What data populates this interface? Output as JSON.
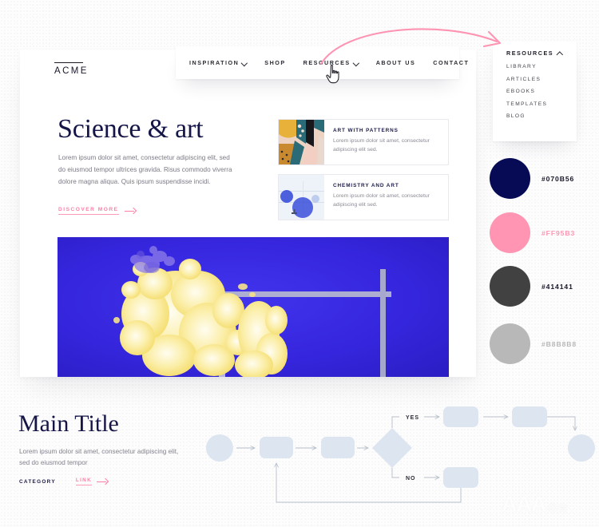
{
  "brand": {
    "logo_text": "ACME"
  },
  "nav": {
    "items": [
      {
        "label": "INSPIRATION",
        "has_caret": true,
        "caret": "chevron-down-icon"
      },
      {
        "label": "SHOP",
        "has_caret": false,
        "caret": ""
      },
      {
        "label": "RESOURCES",
        "has_caret": true,
        "caret": "chevron-down-icon"
      },
      {
        "label": "ABOUT US",
        "has_caret": false,
        "caret": ""
      },
      {
        "label": "CONTACT",
        "has_caret": false,
        "caret": ""
      }
    ],
    "cursor_icon": "pointing-hand-cursor",
    "annotation_arrow_icon": "curved-arrow-icon"
  },
  "dropdown": {
    "title": "RESOURCES",
    "caret": "chevron-up-icon",
    "items": [
      "LIBRARY",
      "ARTICLES",
      "EBOOKS",
      "TEMPLATES",
      "BLOG"
    ]
  },
  "hero": {
    "title": "Science & art",
    "body": "Lorem ipsum dolor sit amet, consectetur adipiscing elit, sed do eiusmod tempor ultrices gravida. Risus commodo viverra dolore magna aliqua. Quis ipsum suspendisse incidi.",
    "cta_label": "DISCOVER MORE",
    "cta_icon": "arrow-right-icon",
    "image_alt": "yellow-ink-in-blue-water-image"
  },
  "articles": [
    {
      "title": "ART WITH PATTERNS",
      "desc": "Lorem ipsum dolor sit amet, consectetur adipiscing elit sed.",
      "thumb": "abstract-pattern-thumbnail"
    },
    {
      "title": "CHEMISTRY AND ART",
      "desc": "Lorem ipsum dolor sit amet, consectetur adipiscing elit sed.",
      "thumb": "blue-circles-thumbnail"
    }
  ],
  "palette": [
    {
      "hex": "#070B56",
      "label": "#070B56",
      "label_color": "#16162a"
    },
    {
      "hex": "#FF95B3",
      "label": "#FF95B3",
      "label_color": "#ff95b3"
    },
    {
      "hex": "#414141",
      "label": "#414141",
      "label_color": "#16162a"
    },
    {
      "hex": "#B8B8B8",
      "label": "#B8B8B8",
      "label_color": "#b8b8b8"
    }
  ],
  "bottom": {
    "title": "Main Title",
    "body": "Lorem ipsum dolor sit amet, consectetur adipiscing elit, sed do eiusmod tempor",
    "category_label": "CATEGORY",
    "link_label": "LINK",
    "link_icon": "arrow-right-icon"
  },
  "flowchart": {
    "branch_yes": "YES",
    "branch_no": "NO",
    "start_shape": "circle",
    "end_shape": "circle",
    "decision_shape": "diamond",
    "fill": "#dce5f0"
  },
  "watermark": {
    "text": "AAA",
    "subtext": "教育"
  }
}
